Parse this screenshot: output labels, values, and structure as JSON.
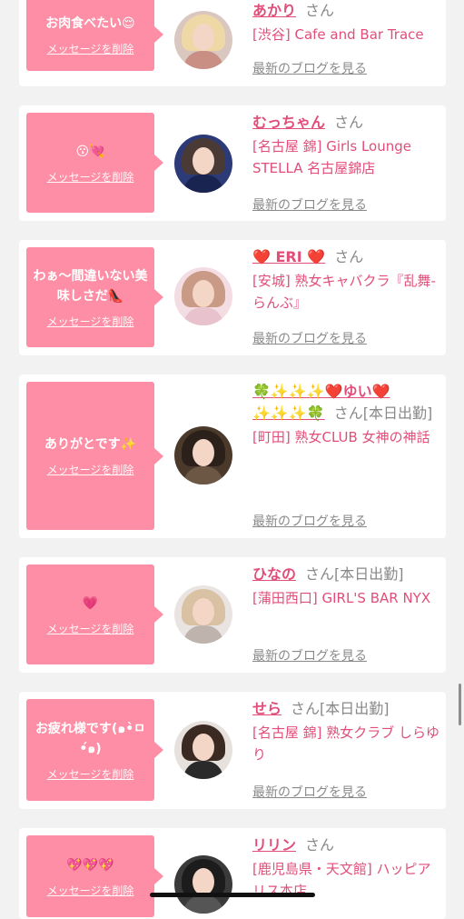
{
  "common": {
    "delete_label": "メッセージを削除",
    "blog_label": "最新のブログを見る",
    "san": "さん"
  },
  "cards": [
    {
      "message": "お肉食べたい😌",
      "name": "あかり",
      "suffix": "",
      "shop": "[渋谷] Cafe and Bar Trace"
    },
    {
      "message": "😗💘",
      "name": "むっちゃん",
      "suffix": "",
      "shop": "[名古屋 錦] Girls Lounge STELLA 名古屋錦店"
    },
    {
      "message": "わぁ〜間違いない美味しさだ👠",
      "name": "❤️ ERI ❤️",
      "suffix": "",
      "shop": "[安城] 熟女キャバクラ『乱舞-らんぶ』"
    },
    {
      "message": "ありがとです✨",
      "name": "🍀✨✨✨❤️ゆい❤️✨✨✨🍀",
      "suffix": "[本日出勤]",
      "shop": "[町田] 熟女CLUB 女神の神話"
    },
    {
      "message": "💗",
      "name": "ひなの",
      "suffix": "[本日出勤]",
      "shop": "[蒲田西口] GIRL'S BAR NYX"
    },
    {
      "message": "お疲れ様です(๑•̀ㅁ•́๑)",
      "name": "せら",
      "suffix": "[本日出勤]",
      "shop": "[名古屋 錦] 熟女クラブ しらゆり"
    },
    {
      "message": "💖💖💖",
      "name": "リリン",
      "suffix": "",
      "shop": "[鹿児島県・天文館] ハッピアリス本店"
    }
  ],
  "colors": {
    "accent": "#e14e79",
    "bubble": "#fd8ea5",
    "background": "#f2f2f2"
  }
}
